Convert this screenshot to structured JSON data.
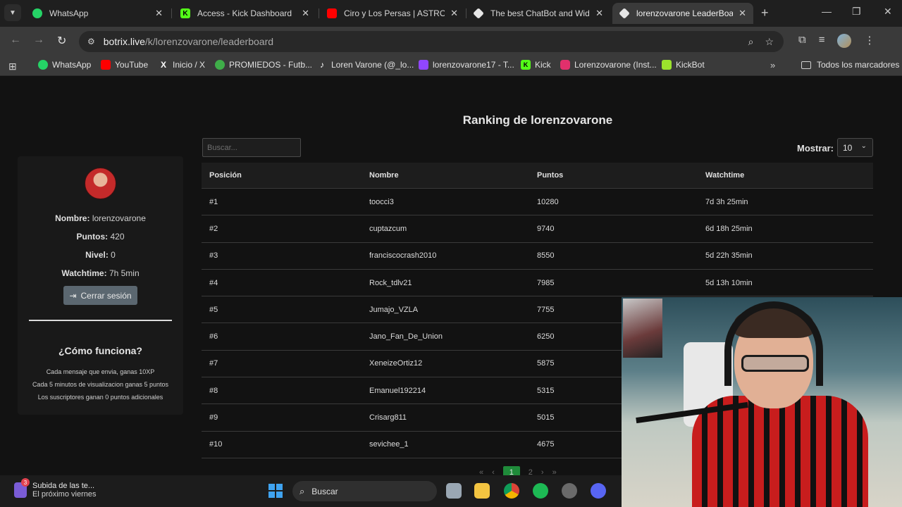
{
  "browser": {
    "tabs": [
      {
        "title": "WhatsApp",
        "favicon_color": "#25d366",
        "active": false
      },
      {
        "title": "Access - Kick Dashboard",
        "favicon_color": "#53fc18",
        "active": false
      },
      {
        "title": "Ciro y Los Persas | ASTROS (",
        "favicon_color": "#ff0000",
        "active": false
      },
      {
        "title": "The best ChatBot and Widge",
        "favicon_color": "#e6e6e6",
        "active": false
      },
      {
        "title": "lorenzovarone LeaderBoard",
        "favicon_color": "#e6e6e6",
        "active": true
      }
    ],
    "url_host": "botrix.live",
    "url_path": "/k/lorenzovarone/leaderboard",
    "bookmarks": [
      {
        "label": "WhatsApp",
        "color": "#25d366"
      },
      {
        "label": "YouTube",
        "color": "#ff0000"
      },
      {
        "label": "Inicio / X",
        "color": "#ffffff"
      },
      {
        "label": "PROMIEDOS - Futb...",
        "color": "#3fae49"
      },
      {
        "label": "Loren Varone (@_lo...",
        "color": "#ffffff"
      },
      {
        "label": "lorenzovarone17 - T...",
        "color": "#9146ff"
      },
      {
        "label": "Kick",
        "color": "#53fc18"
      },
      {
        "label": "Lorenzovarone (Inst...",
        "color": "#e1306c"
      },
      {
        "label": "KickBot",
        "color": "#9be22d"
      }
    ],
    "bookmarks_folder": "Todos los marcadores"
  },
  "profile": {
    "nombre_label": "Nombre:",
    "nombre": "lorenzovarone",
    "puntos_label": "Puntos:",
    "puntos": "420",
    "nivel_label": "Nivel:",
    "nivel": "0",
    "watchtime_label": "Watchtime:",
    "watchtime": "7h 5min",
    "logout_label": "Cerrar sesión",
    "how_title": "¿Cómo funciona?",
    "how_lines": [
      "Cada mensaje que envia, ganas 10XP",
      "Cada 5 minutos de visualizacion ganas 5 puntos",
      "Los suscriptores ganan 0 puntos adicionales"
    ]
  },
  "leaderboard": {
    "title": "Ranking de lorenzovarone",
    "search_placeholder": "Buscar...",
    "show_label": "Mostrar:",
    "show_value": "10",
    "columns": [
      "Posición",
      "Nombre",
      "Puntos",
      "Watchtime"
    ],
    "rows": [
      [
        "#1",
        "toocci3",
        "10280",
        "7d 3h 25min"
      ],
      [
        "#2",
        "cuptazcum",
        "9740",
        "6d 18h 25min"
      ],
      [
        "#3",
        "franciscocrash2010",
        "8550",
        "5d 22h 35min"
      ],
      [
        "#4",
        "Rock_tdlv21",
        "7985",
        "5d 13h 10min"
      ],
      [
        "#5",
        "Jumajo_VZLA",
        "7755",
        ""
      ],
      [
        "#6",
        "Jano_Fan_De_Union",
        "6250",
        ""
      ],
      [
        "#7",
        "XeneizeOrtiz12",
        "5875",
        ""
      ],
      [
        "#8",
        "Emanuel192214",
        "5315",
        ""
      ],
      [
        "#9",
        "Crisarg811",
        "5015",
        ""
      ],
      [
        "#10",
        "sevichee_1",
        "4675",
        ""
      ]
    ],
    "pager": {
      "first": "«",
      "prev": "‹",
      "current": "1",
      "next_page": "2",
      "next": "›",
      "last": "»"
    }
  },
  "taskbar": {
    "notification_title": "Subida de las te...",
    "notification_sub": "El próximo viernes",
    "notification_badge": "3",
    "search_label": "Buscar"
  }
}
